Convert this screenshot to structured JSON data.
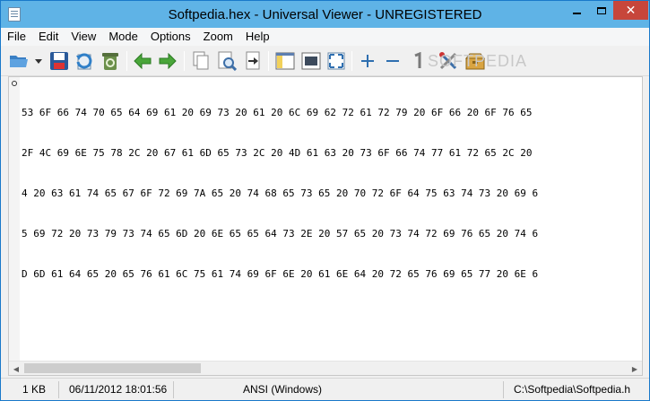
{
  "window": {
    "title": "Softpedia.hex - Universal Viewer - UNREGISTERED"
  },
  "menu": [
    "File",
    "Edit",
    "View",
    "Mode",
    "Options",
    "Zoom",
    "Help"
  ],
  "toolbar": {
    "watermark": "SOFTPEDIA"
  },
  "hex_lines": [
    "53 6F 66 74 70 65 64 69 61 20 69 73 20 61 20 6C 69 62 72 61 72 79 20 6F 66 20 6F 76 65",
    "2F 4C 69 6E 75 78 2C 20 67 61 6D 65 73 2C 20 4D 61 63 20 73 6F 66 74 77 61 72 65 2C 20",
    "4 20 63 61 74 65 67 6F 72 69 7A 65 20 74 68 65 73 65 20 70 72 6F 64 75 63 74 73 20 69 6",
    "5 69 72 20 73 79 73 74 65 6D 20 6E 65 65 64 73 2E 20 57 65 20 73 74 72 69 76 65 20 74 6",
    "D 6D 61 64 65 20 65 76 61 6C 75 61 74 69 6F 6E 20 61 6E 64 20 72 65 76 69 65 77 20 6E 6"
  ],
  "status": {
    "size": "1 KB",
    "datetime": "06/11/2012 18:01:56",
    "encoding": "ANSI (Windows)",
    "path": "C:\\Softpedia\\Softpedia.h"
  }
}
